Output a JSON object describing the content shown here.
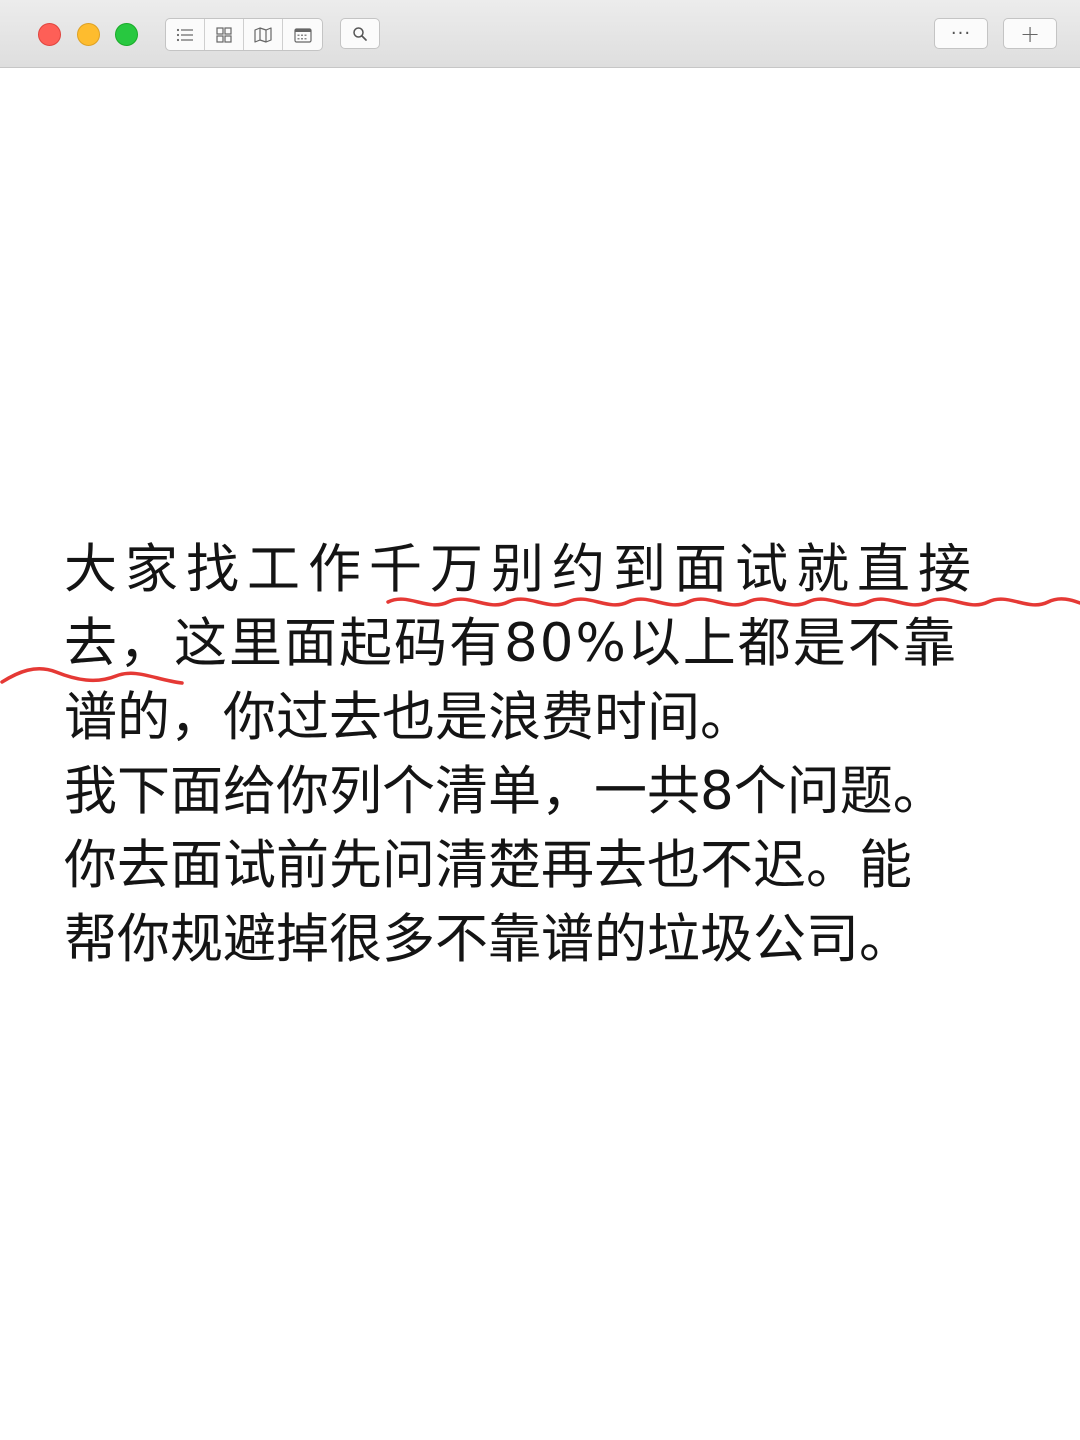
{
  "window": {
    "title": "",
    "traffic_lights": {
      "close_color": "#fe5f57",
      "minimize_color": "#febc2e",
      "maximize_color": "#28c840"
    },
    "toolbar": {
      "view_buttons": [
        "list-view-icon",
        "grid-view-icon",
        "map-view-icon",
        "calendar-view-icon"
      ],
      "search_icon": "search-icon",
      "more_label": "···",
      "add_label": "+"
    }
  },
  "note": {
    "lines": [
      "大家找工作千万别约到面试就直接",
      "去，这里面起码有80%以上都是不靠",
      "谱的，你过去也是浪费时间。",
      "我下面给你列个清单，一共8个问题。",
      "你去面试前先问清楚再去也不迟。能",
      "帮你规避掉很多不靠谱的垃圾公司。"
    ],
    "text_color": "#141414",
    "underline_color": "#e53935"
  }
}
